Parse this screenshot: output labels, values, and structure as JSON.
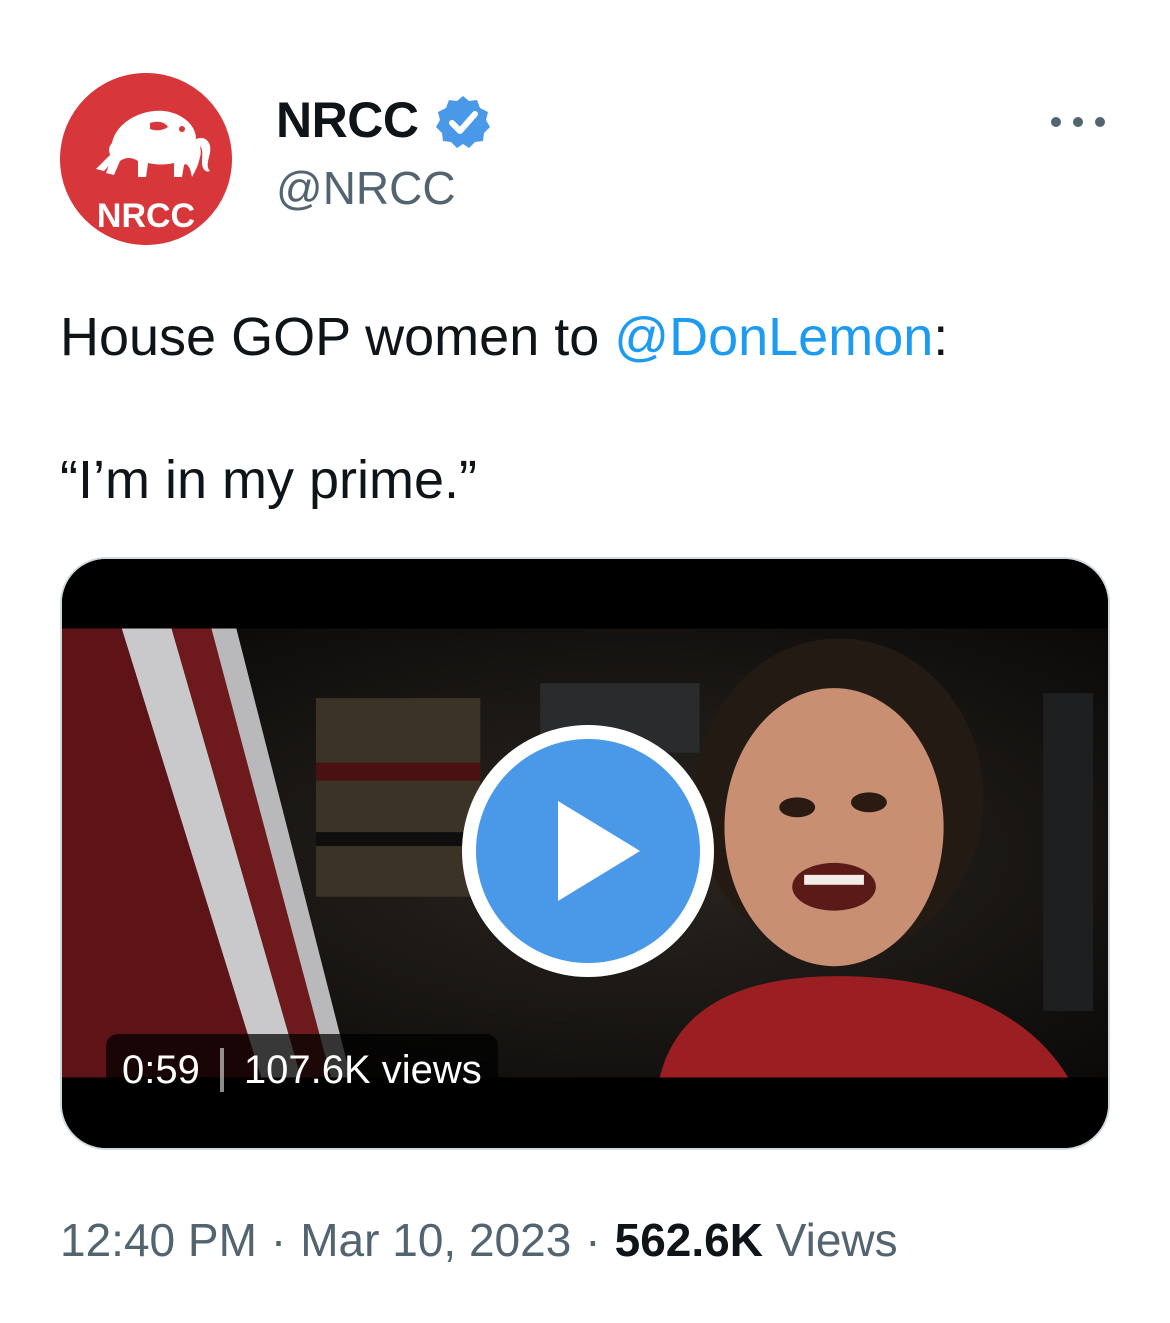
{
  "author": {
    "display_name": "NRCC",
    "handle": "@NRCC",
    "avatar_text": "NRCC",
    "verified": true,
    "colors": {
      "avatar_bg": "#d7363b",
      "verified_badge": "#4a99e9"
    }
  },
  "tweet": {
    "text_prefix": "House GOP women to ",
    "mention": "@DonLemon",
    "text_suffix": ":",
    "quote": "“I’m in my prime.”"
  },
  "video": {
    "duration": "0:59",
    "views": "107.6K views",
    "play_icon": "play-icon",
    "colors": {
      "play_button": "#4a99e9"
    }
  },
  "meta": {
    "time": "12:40 PM",
    "date": "Mar 10, 2023",
    "separator": "·",
    "view_count": "562.6K",
    "view_label": "Views"
  },
  "icons": {
    "more": "more-horizontal-icon",
    "verified": "verified-badge-icon"
  },
  "colors": {
    "link": "#1d9bf0",
    "secondary_text": "#536471",
    "primary_text": "#0f1419"
  }
}
